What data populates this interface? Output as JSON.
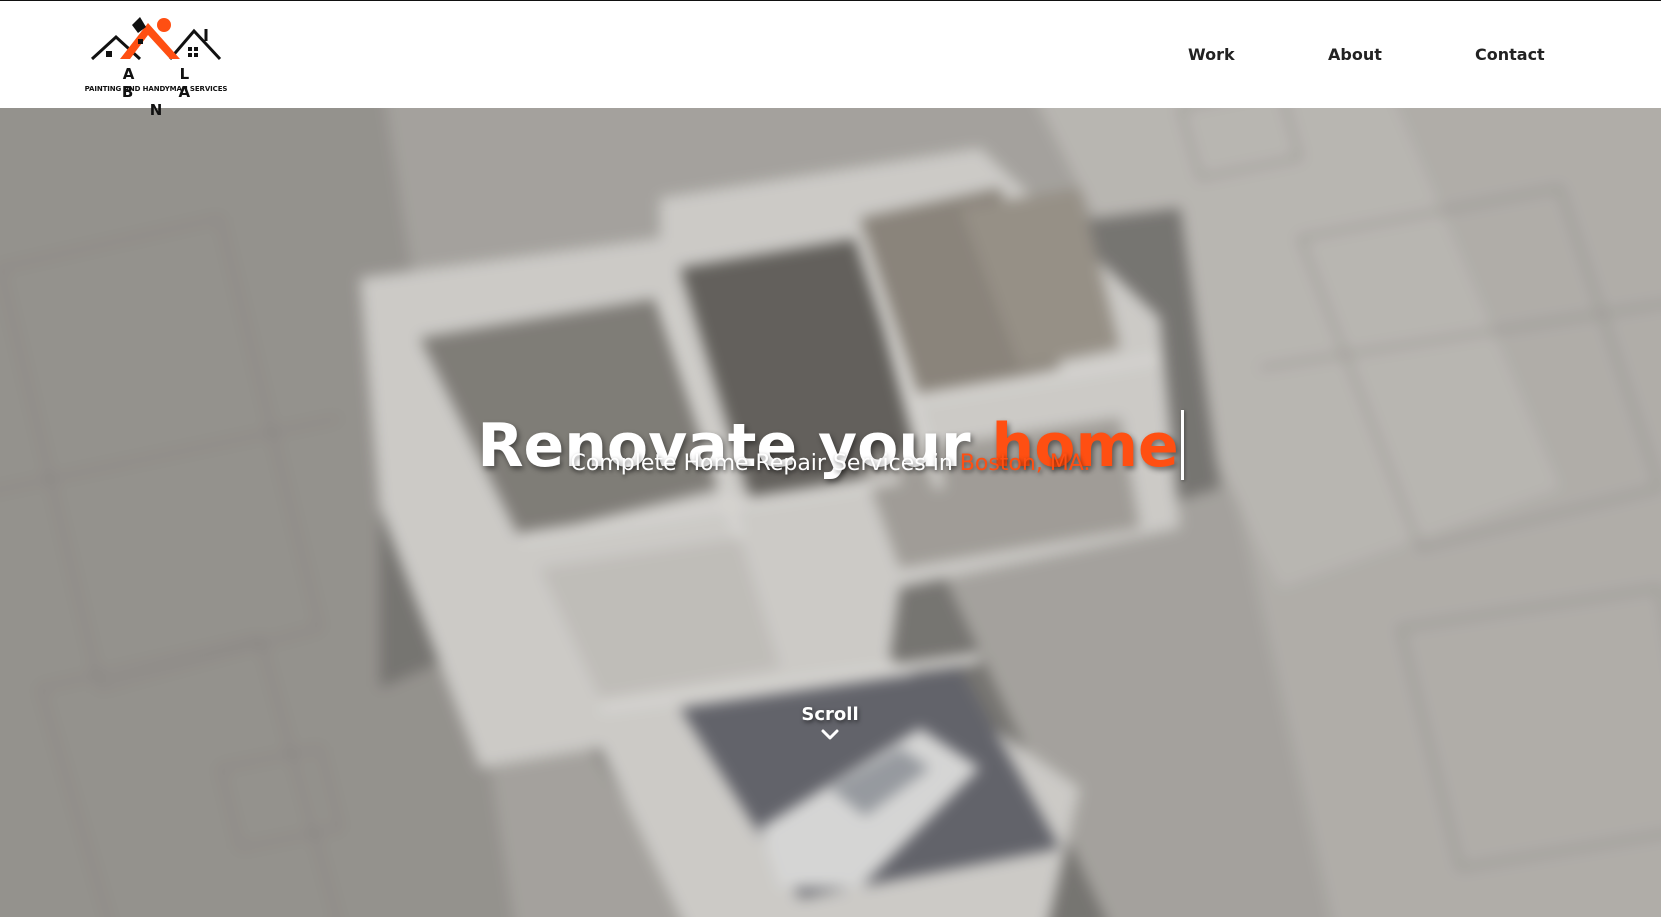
{
  "logo": {
    "name": "A L B A N",
    "tagline": "PAINTING AND HANDYMAN SERVICES",
    "brand_color": "#ff4f12"
  },
  "nav": {
    "items": [
      {
        "label": "Work"
      },
      {
        "label": "About"
      },
      {
        "label": "Contact"
      }
    ]
  },
  "hero": {
    "headline_prefix": "Renovate your ",
    "headline_accent": "home",
    "subline_prefix": "Complete Home Repair Services in ",
    "subline_accent": "Boston, MA.",
    "accent_color": "#ff4f12",
    "scroll_label": "Scroll",
    "scroll_icon": "chevron-down-icon",
    "background": "blurred 3D floor plan render"
  }
}
